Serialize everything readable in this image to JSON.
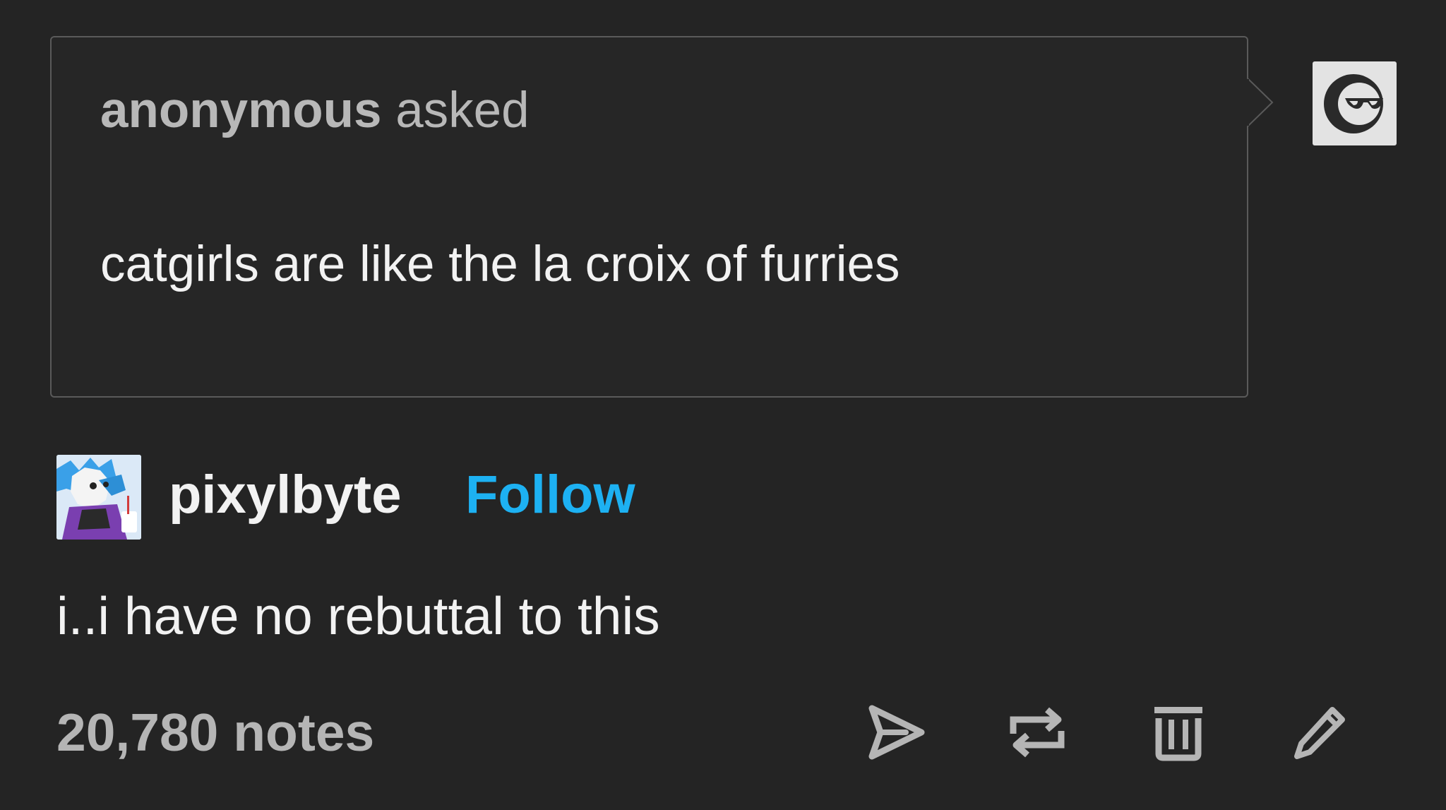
{
  "ask": {
    "asker": "anonymous",
    "asked_label": "asked",
    "question": "catgirls are like the la croix of furries",
    "avatar_icon": "anonymous-sunglasses-icon"
  },
  "reply": {
    "username": "pixylbyte",
    "follow_label": "Follow",
    "text": "i..i have no rebuttal to this"
  },
  "footer": {
    "notes": "20,780 notes",
    "actions": [
      "send-icon",
      "reblog-icon",
      "delete-icon",
      "edit-icon"
    ]
  },
  "colors": {
    "background": "#242424",
    "follow_accent": "#1db1f2",
    "border": "#5a5a5a"
  }
}
